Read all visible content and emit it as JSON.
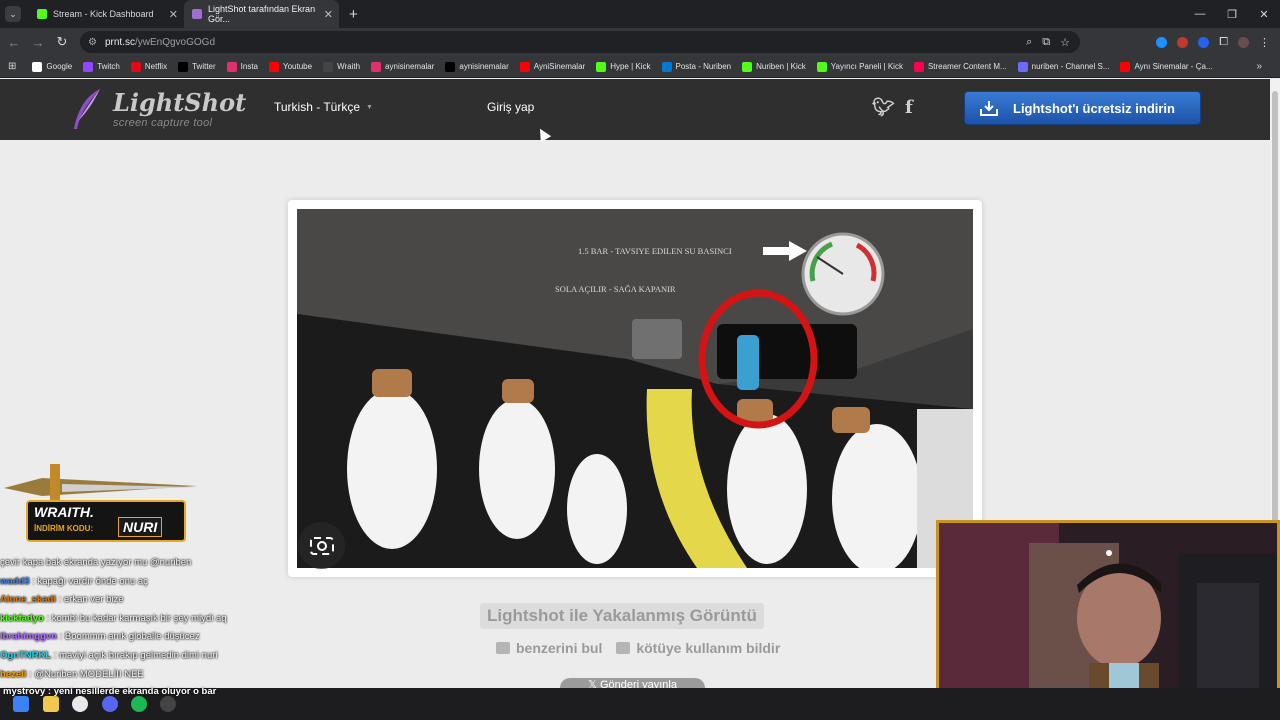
{
  "browser": {
    "tabs": [
      {
        "title": "Stream - Kick Dashboard",
        "icon": "kick-icon",
        "active": false
      },
      {
        "title": "LightShot tarafından Ekran Gör...",
        "icon": "lightshot-icon",
        "active": true
      }
    ],
    "url_host": "prnt.sc",
    "url_path": "/ywEnQgvoGOGd",
    "bookmarks": [
      {
        "label": "Google",
        "color": "#ffffff"
      },
      {
        "label": "Twitch",
        "color": "#9146ff"
      },
      {
        "label": "Netflix",
        "color": "#e50914"
      },
      {
        "label": "Twitter",
        "color": "#000000"
      },
      {
        "label": "Insta",
        "color": "#e1306c"
      },
      {
        "label": "Youtube",
        "color": "#ff0000"
      },
      {
        "label": "Wraith",
        "color": "#444444"
      },
      {
        "label": "aynisinemalar",
        "color": "#e1306c"
      },
      {
        "label": "aynisinemalar",
        "color": "#000000"
      },
      {
        "label": "AyniSinemalar",
        "color": "#ff0000"
      },
      {
        "label": "Hype | Kick",
        "color": "#53fc18"
      },
      {
        "label": "Posta - Nuriben",
        "color": "#0078d4"
      },
      {
        "label": "Nuriben | Kick",
        "color": "#53fc18"
      },
      {
        "label": "Yayıncı Paneli | Kick",
        "color": "#53fc18"
      },
      {
        "label": "Streamer Content M...",
        "color": "#ff0050"
      },
      {
        "label": "nuriben - Channel S...",
        "color": "#6b6bff"
      },
      {
        "label": "Aynı Sinemalar - Ça...",
        "color": "#ff0000"
      }
    ]
  },
  "site": {
    "logo_title": "LightShot",
    "logo_subtitle": "screen capture tool",
    "language": "Turkish - Türkçe",
    "login": "Giriş yap",
    "download_button": "Lightshot'ı ücretsiz indirin",
    "screenshot_text_1": "1.5 BAR - TAVSIYE EDILEN SU BASINCI",
    "screenshot_text_2": "SOLA AÇILIR - SAĞA KAPANIR",
    "caption": "Lightshot ile Yakalanmış Görüntü",
    "find_similar": "benzerini bul",
    "report_abuse": "kötüye kullanım bildir",
    "share_button": "Gönderi yayınla"
  },
  "overlay": {
    "sponsor_brand": "WRAITH.",
    "sponsor_code_label": "İNDİRİM KODU:",
    "sponsor_code": "NURI",
    "chat": [
      {
        "user": "",
        "color": "#ffffff",
        "text": "çevir kapa bak ekranda yazıyor mu @nuriben"
      },
      {
        "user": "wadd3",
        "color": "#3b82f6",
        "text": ": kapağı vardır önde onu aç"
      },
      {
        "user": "Alone_skadi",
        "color": "#d97706",
        "text": ": erkan ver bize"
      },
      {
        "user": "kickfadyo",
        "color": "#53fc18",
        "text": ": kombi bu kadar karmaşık bir şey miydi aq"
      },
      {
        "user": "ibrahimggvn",
        "color": "#b06bff",
        "text": ": Boommm anık globalle düşücez"
      },
      {
        "user": "OgnTNRKL",
        "color": "#22d3ee",
        "text": ": maviyi açık bırakıp gelmedin dimi nuri"
      },
      {
        "user": "hezeli",
        "color": "#f59e0b",
        "text": ": @Nuriben MODELİII NEE"
      },
      {
        "user": "mystrovy",
        "color": "#ffffff",
        "text": ": yeni nesillerde ekranda oluyor o bar"
      }
    ]
  }
}
